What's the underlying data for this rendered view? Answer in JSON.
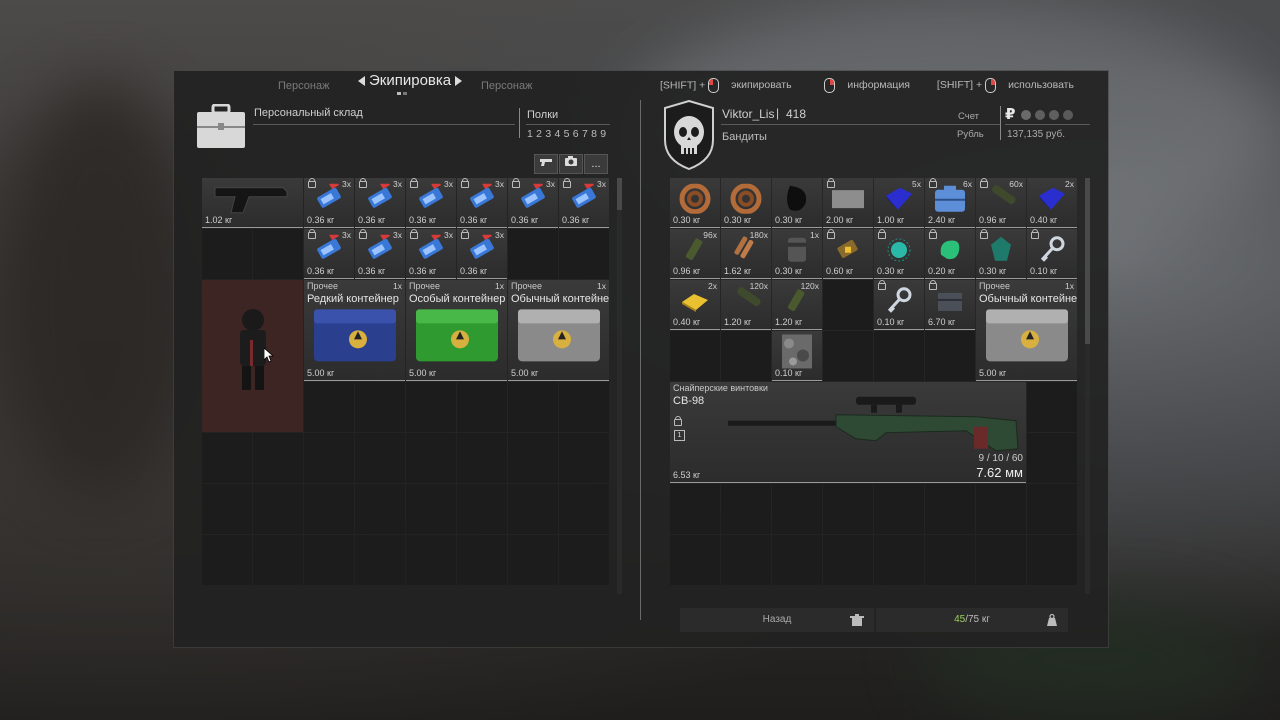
{
  "nav": {
    "left_tab": "Персонаж",
    "active_tab": "Экипировка",
    "right_tab": "Персонаж"
  },
  "hints": {
    "equip_key": "[SHIFT] +",
    "equip_label": "экипировать",
    "info_label": "информация",
    "use_key": "[SHIFT] +",
    "use_label": "использовать"
  },
  "stash": {
    "title": "Персональный склад",
    "shelves_label": "Полки",
    "shelf_numbers": "1 2 3 4 5 6 7 8 9",
    "active_shelf": "3",
    "more_label": "..."
  },
  "player": {
    "name": "Viktor_Lis",
    "level": "418",
    "faction": "Бандиты",
    "account_label": "Счет",
    "currency_label": "Рубль",
    "balance": "137,135 руб.",
    "currency_symbol": "₽"
  },
  "stash_items": [
    {
      "weight": "1.02 кг",
      "qty": "",
      "lock": false
    },
    {
      "weight": "0.36 кг",
      "qty": "3x",
      "lock": true
    },
    {
      "weight": "0.36 кг",
      "qty": "3x",
      "lock": true
    },
    {
      "weight": "0.36 кг",
      "qty": "3x",
      "lock": true
    },
    {
      "weight": "0.36 кг",
      "qty": "3x",
      "lock": true
    },
    {
      "weight": "0.36 кг",
      "qty": "3x",
      "lock": true
    },
    {
      "weight": "0.36 кг",
      "qty": "3x",
      "lock": true
    },
    {
      "weight": "0.36 кг",
      "qty": "3x",
      "lock": true
    },
    {
      "weight": "0.36 кг",
      "qty": "3x",
      "lock": true
    },
    {
      "weight": "0.36 кг",
      "qty": "3x",
      "lock": true
    },
    {
      "weight": "0.36 кг",
      "qty": "3x",
      "lock": true
    }
  ],
  "containers": [
    {
      "category": "Прочее",
      "qty": "1x",
      "name": "Редкий контейнер",
      "weight": "5.00 кг",
      "color": "#2b3f8f"
    },
    {
      "category": "Прочее",
      "qty": "1x",
      "name": "Особый контейнер",
      "weight": "5.00 кг",
      "color": "#2f9a2f"
    },
    {
      "category": "Прочее",
      "qty": "1x",
      "name": "Обычный контейнер",
      "weight": "5.00 кг",
      "color": "#8a8a8a"
    }
  ],
  "inv_items": [
    {
      "weight": "0.30 кг",
      "qty": ""
    },
    {
      "weight": "0.30 кг",
      "qty": ""
    },
    {
      "weight": "0.30 кг",
      "qty": ""
    },
    {
      "weight": "2.00 кг",
      "qty": ""
    },
    {
      "weight": "1.00 кг",
      "qty": "5x"
    },
    {
      "weight": "2.40 кг",
      "qty": "6x"
    },
    {
      "weight": "0.96 кг",
      "qty": "60x"
    },
    {
      "weight": "0.40 кг",
      "qty": "2x"
    },
    {
      "weight": "0.96 кг",
      "qty": "96x"
    },
    {
      "weight": "1.62 кг",
      "qty": "180x"
    },
    {
      "weight": "0.30 кг",
      "qty": "1x"
    },
    {
      "weight": "0.60 кг",
      "qty": ""
    },
    {
      "weight": "0.30 кг",
      "qty": ""
    },
    {
      "weight": "0.20 кг",
      "qty": ""
    },
    {
      "weight": "0.30 кг",
      "qty": ""
    },
    {
      "weight": "0.10 кг",
      "qty": ""
    },
    {
      "weight": "0.40 кг",
      "qty": "2x"
    },
    {
      "weight": "1.20 кг",
      "qty": "120x"
    },
    {
      "weight": "1.20 кг",
      "qty": "120x"
    },
    {
      "weight": "0.10 кг",
      "qty": ""
    },
    {
      "weight": "6.70 кг",
      "qty": ""
    },
    {
      "weight": "0.10 кг",
      "qty": ""
    }
  ],
  "inv_container": {
    "category": "Прочее",
    "qty": "1x",
    "name": "Обычный контейнер",
    "weight": "5.00 кг"
  },
  "rifle": {
    "category": "Снайперские винтовки",
    "name": "СВ-98",
    "weight": "6.53 кг",
    "ammo": "9 / 10 / 60",
    "caliber": "7.62 мм"
  },
  "footer": {
    "back_label": "Назад",
    "weight_current": "45",
    "weight_max": "/75 кг"
  },
  "colors": {
    "accent": "#e04848",
    "weight_ok": "#9ccf5a"
  }
}
